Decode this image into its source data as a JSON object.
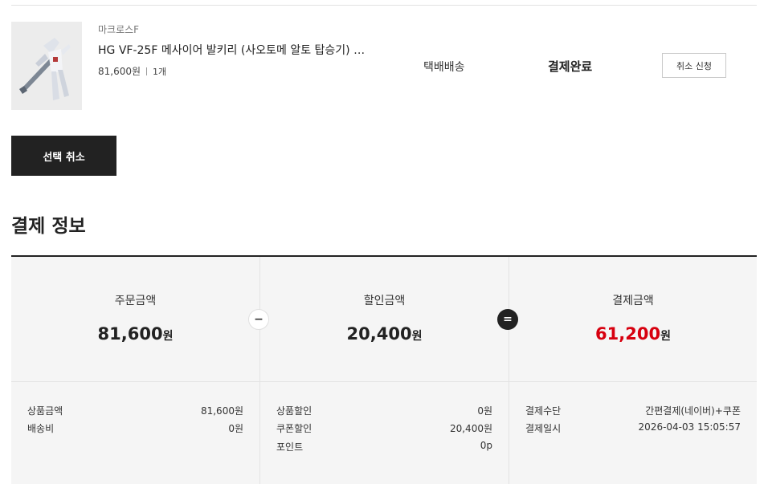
{
  "product": {
    "brand": "마크로스F",
    "name": "HG VF-25F 메사이어 발키리 (사오토메 알토 탑승기) …",
    "price": "81,600원",
    "quantity": "1개",
    "shipping_method": "택배배송",
    "status": "결제완료",
    "cancel_request_label": "취소 신청",
    "thumbnail_icon": "gundam-figure-image"
  },
  "select_cancel_label": "선택 취소",
  "payment_info": {
    "title": "결제 정보",
    "order_amount": {
      "label": "주문금액",
      "value": "81,600",
      "unit": "원"
    },
    "discount_amount": {
      "label": "할인금액",
      "value": "20,400",
      "unit": "원"
    },
    "payment_amount": {
      "label": "결제금액",
      "value": "61,200",
      "unit": "원"
    },
    "operator_minus": "−",
    "operator_equal": "=",
    "accent_color": "#d7000f",
    "details_col1": [
      {
        "label": "상품금액",
        "value": "81,600원"
      },
      {
        "label": "배송비",
        "value": "0원"
      }
    ],
    "details_col2": [
      {
        "label": "상품할인",
        "value": "0원"
      },
      {
        "label": "쿠폰할인",
        "value": "20,400원"
      },
      {
        "label": "포인트",
        "value": "0p"
      }
    ],
    "details_col3": [
      {
        "label": "결제수단",
        "value": "간편결제(네이버)+쿠폰"
      },
      {
        "label": "결제일시",
        "value": "2026-04-03 15:05:57"
      }
    ]
  }
}
